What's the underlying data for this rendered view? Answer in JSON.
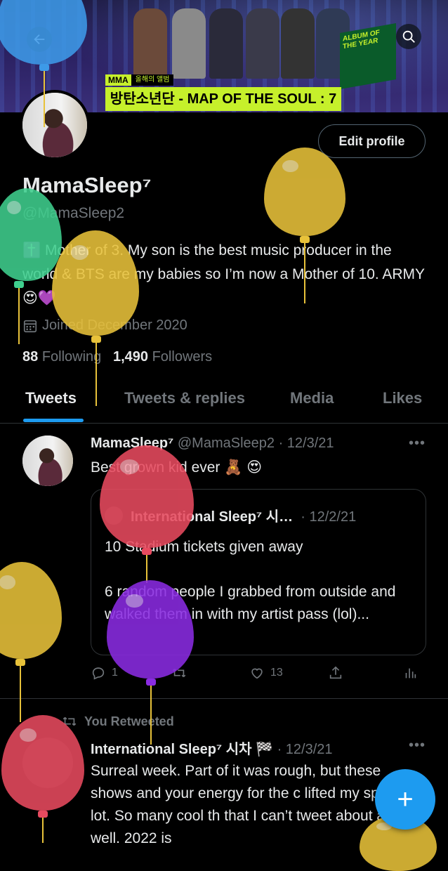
{
  "banner": {
    "badge": "MMA",
    "badge_sub": "올해의 앨범",
    "caption": "방탄소년단 - MAP OF THE SOUL : 7",
    "album_tag": "ALBUM OF THE YEAR",
    "back_icon": "arrow-left-icon",
    "search_icon": "search-icon"
  },
  "profile": {
    "name": "MamaSleep⁷",
    "handle": "@MamaSleep2",
    "edit_button": "Edit profile",
    "bio": "✝️ Mother of 3. My son is the best music producer in the world & BTS are my babies so I’m now a Mother of 10. ARMY 😍💜",
    "joined": "Joined December 2020",
    "following_count": "88",
    "following_label": "Following",
    "followers_count": "1,490",
    "followers_label": "Followers"
  },
  "tabs": [
    "Tweets",
    "Tweets & replies",
    "Media",
    "Likes"
  ],
  "tweet1": {
    "name": "MamaSleep⁷",
    "handle_date": "@MamaSleep2 · 12/3/21",
    "text": "Best grown kid ever 🧸 😍",
    "quote": {
      "name": "International Sleep⁷ 시…",
      "date": "· 12/2/21",
      "text": "10 Stadium tickets given away\n\n6 random people I grabbed from outside and walked them in with my artist pass (lol)..."
    },
    "reply_count": "1",
    "retweet_count": "",
    "like_count": "13"
  },
  "tweet2": {
    "retweet_label": "You Retweeted",
    "name": "International Sleep⁷ 시차 🏁",
    "date": "· 12/3/21",
    "text": "Surreal week. Part of it was rough, but these shows and your energy for the c lifted my spirits a lot. So many cool th that I can’t tweet about as well. 2022 is"
  },
  "fab_label": "+",
  "colors": {
    "accent": "#1d9bf0",
    "balloon_yellow": "#e8c23a",
    "balloon_green": "#3fcf8e",
    "balloon_red": "#e84a5f",
    "balloon_purple": "#8a2be2",
    "balloon_blue": "#3d9ae8"
  }
}
